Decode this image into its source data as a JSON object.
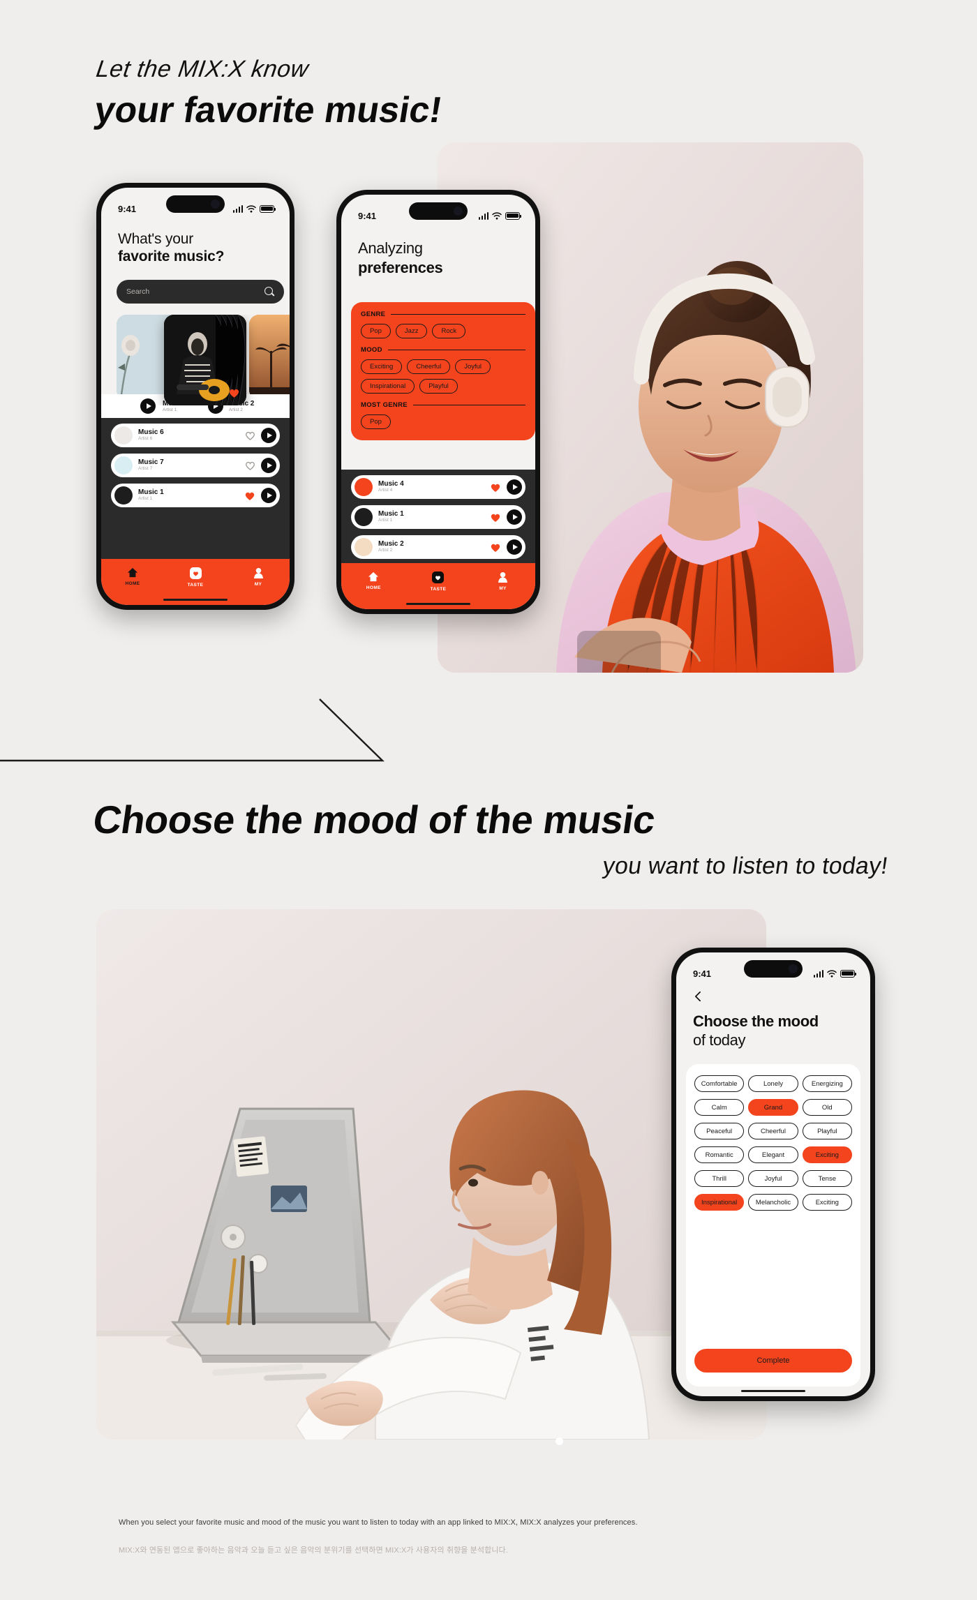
{
  "theme": {
    "accent": "#f4441e",
    "bg": "#f0eeec",
    "dark": "#2b2b2b",
    "ink": "#111111"
  },
  "section1": {
    "kicker": "Let the MIX:X know",
    "title": "your favorite music!"
  },
  "section2": {
    "title": "Choose the mood of the music",
    "subtitle": "you want to listen to today!"
  },
  "phone1": {
    "status": {
      "time": "9:41",
      "signal": "cellular-signal-icon",
      "wifi": "wifi-icon",
      "battery": "battery-full-icon"
    },
    "heading_line1": "What's your",
    "heading_line2": "favorite music?",
    "search": {
      "placeholder": "Search",
      "icon": "search-icon"
    },
    "carousel": [
      {
        "title": "",
        "liked": false,
        "art": "rose-photo"
      },
      {
        "title": "",
        "liked": true,
        "art": "guitarist-photo"
      },
      {
        "title": "",
        "liked": false,
        "art": "palm-sunset-photo"
      }
    ],
    "carousel_labels": [
      {
        "name": "Music 1",
        "artist": "Artist 1"
      },
      {
        "name": "Music 2",
        "artist": "Artist 2"
      }
    ],
    "tracks": [
      {
        "name": "Music 6",
        "artist": "Artist 6",
        "liked": false,
        "thumb": "#ece9e6"
      },
      {
        "name": "Music 7",
        "artist": "Artist 7",
        "liked": false,
        "thumb": "#d9eef2"
      },
      {
        "name": "Music 1",
        "artist": "Artist 1",
        "liked": true,
        "thumb": "#1d1d1d"
      }
    ],
    "tabs": [
      {
        "label": "HOME",
        "icon": "home-icon",
        "active": true
      },
      {
        "label": "TASTE",
        "icon": "heart-square-icon",
        "active": false
      },
      {
        "label": "MY",
        "icon": "user-icon",
        "active": false
      }
    ]
  },
  "phone2": {
    "status": {
      "time": "9:41"
    },
    "heading_line1": "Analyzing",
    "heading_line2": "preferences",
    "sections": [
      {
        "label": "GENRE",
        "chips": [
          "Pop",
          "Jazz",
          "Rock"
        ]
      },
      {
        "label": "MOOD",
        "chips": [
          "Exciting",
          "Cheerful",
          "Joyful",
          "Inspirational",
          "Playful"
        ]
      },
      {
        "label": "MOST GENRE",
        "chips": [
          "Pop"
        ]
      }
    ],
    "tracks": [
      {
        "name": "Music 4",
        "artist": "Artist 4",
        "liked": true,
        "thumb": "#f4441e"
      },
      {
        "name": "Music 1",
        "artist": "Artist 1",
        "liked": true,
        "thumb": "#1d1d1d"
      },
      {
        "name": "Music 2",
        "artist": "Artist 2",
        "liked": true,
        "thumb": "#f3dcc2"
      }
    ],
    "tabs": [
      {
        "label": "HOME",
        "icon": "home-icon",
        "active": false
      },
      {
        "label": "TASTE",
        "icon": "heart-square-icon",
        "active": true
      },
      {
        "label": "MY",
        "icon": "user-icon",
        "active": false
      }
    ]
  },
  "phone3": {
    "status": {
      "time": "9:41"
    },
    "back_icon": "chevron-left-icon",
    "heading_line1": "Choose the mood",
    "heading_line2": "of today",
    "moods": [
      {
        "label": "Comfortable",
        "selected": false
      },
      {
        "label": "Lonely",
        "selected": false
      },
      {
        "label": "Energizing",
        "selected": false
      },
      {
        "label": "Calm",
        "selected": false
      },
      {
        "label": "Grand",
        "selected": true
      },
      {
        "label": "Old",
        "selected": false
      },
      {
        "label": "Peaceful",
        "selected": false
      },
      {
        "label": "Cheerful",
        "selected": false
      },
      {
        "label": "Playful",
        "selected": false
      },
      {
        "label": "Romantic",
        "selected": false
      },
      {
        "label": "Elegant",
        "selected": false
      },
      {
        "label": "Exciting",
        "selected": true
      },
      {
        "label": "Thrill",
        "selected": false
      },
      {
        "label": "Joyful",
        "selected": false
      },
      {
        "label": "Tense",
        "selected": false
      },
      {
        "label": "Inspirational",
        "selected": true
      },
      {
        "label": "Melancholic",
        "selected": false
      },
      {
        "label": "Exciting",
        "selected": false
      }
    ],
    "complete_label": "Complete"
  },
  "caption": {
    "en": "When you select your favorite music and mood of the music you want to listen to today with an app linked to MIX:X, MIX:X analyzes your preferences.",
    "ko": "MIX:X와 연동된 앱으로 좋아하는 음악과 오늘 듣고 싶은 음악의 분위기를 선택하면 MIX:X가 사용자의 취향을 분석합니다."
  }
}
